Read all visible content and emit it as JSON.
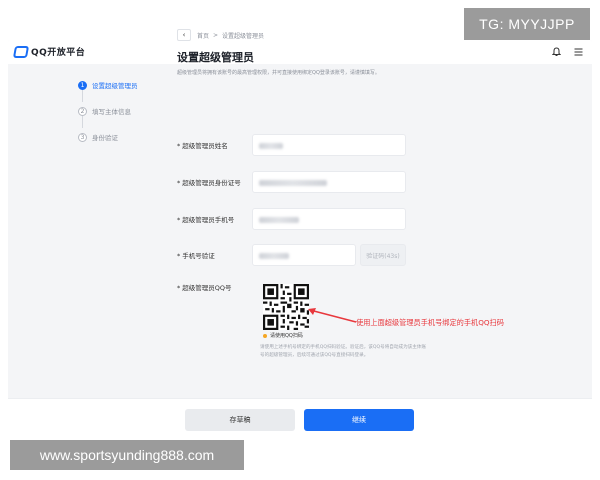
{
  "watermarks": {
    "top_right": "TG: MYYJJPP",
    "bottom_left": "www.sportsyunding888.com"
  },
  "header": {
    "logo_text": "QQ开放平台",
    "icons": [
      "bell-icon",
      "menu-icon"
    ]
  },
  "steps": [
    {
      "num": "1",
      "label": "设置超级管理员",
      "active": true
    },
    {
      "num": "2",
      "label": "填写主体信息",
      "active": false
    },
    {
      "num": "3",
      "label": "身份验证",
      "active": false
    }
  ],
  "breadcrumb": {
    "home": "首页",
    "separator": ">",
    "current": "设置超级管理员"
  },
  "main": {
    "title": "设置超级管理员",
    "description": "超级管理员将拥有该账号的最高管理权限，并可直接使用绑定QQ登录该账号，请谨慎填写。"
  },
  "form": {
    "name_label": "超级管理员姓名",
    "id_label": "超级管理员身份证号",
    "phone_label": "超级管理员手机号",
    "verify_label": "手机号验证",
    "code_button": "验证码(43s)",
    "qq_label": "超级管理员QQ号",
    "qr_caption": "请使用QQ扫码",
    "qr_help": "请使用上述手机号绑定的手机QQ扫码验证。验证后，该QQ号将自动成为该主体账号的超级管理员，后续可通过该QQ号直接扫码登录。"
  },
  "annotation": "使用上面超级管理员手机号绑定的手机QQ扫码",
  "footer": {
    "draft_button": "存草稿",
    "continue_button": "继续"
  },
  "colors": {
    "primary": "#1a6ef5",
    "annotation": "#e8383d",
    "background": "#f4f5f7"
  }
}
